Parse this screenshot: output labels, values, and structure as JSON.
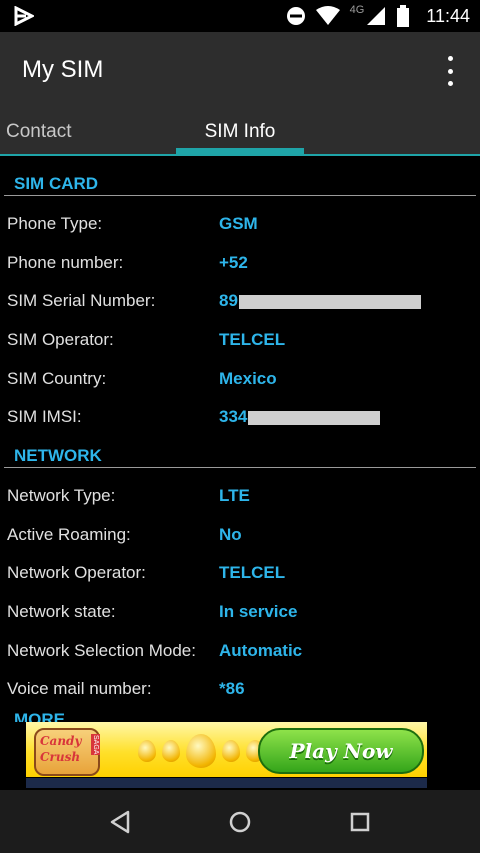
{
  "status_bar": {
    "network_label": "4G",
    "time": "11:44"
  },
  "app_bar": {
    "title": "My SIM"
  },
  "tabs": [
    {
      "label": "Contact",
      "selected": false
    },
    {
      "label": "SIM Info",
      "selected": true
    }
  ],
  "sim_card": {
    "header": "SIM CARD",
    "rows": [
      {
        "label": "Phone Type:",
        "value": "GSM"
      },
      {
        "label": "Phone number:",
        "value": "+52"
      },
      {
        "label": "SIM Serial Number:",
        "value": "89"
      },
      {
        "label": "SIM Operator:",
        "value": "TELCEL"
      },
      {
        "label": "SIM Country:",
        "value": "Mexico"
      },
      {
        "label": "SIM IMSI:",
        "value": "334"
      }
    ]
  },
  "network": {
    "header": "NETWORK",
    "rows": [
      {
        "label": "Network Type:",
        "value": "LTE"
      },
      {
        "label": "Active Roaming:",
        "value": "No"
      },
      {
        "label": "Network Operator:",
        "value": "TELCEL"
      },
      {
        "label": "Network state:",
        "value": "In service"
      },
      {
        "label": "Network Selection Mode:",
        "value": "Automatic"
      },
      {
        "label": "Voice mail number:",
        "value": "*86"
      }
    ]
  },
  "next_section": {
    "header": "MORE"
  },
  "ad": {
    "logo_line1": "Candy",
    "logo_line2": "Crush",
    "logo_tag": "SAGA",
    "button": "Play Now"
  },
  "colors": {
    "accent": "#2eb5ea",
    "tab_indicator": "#1fa4a8",
    "app_bar": "#2d2d2d",
    "background": "#000000"
  },
  "icons": {
    "status_left": "notification-play-icon",
    "dnd": "do-not-disturb-icon",
    "wifi": "wifi-icon",
    "signal": "cell-signal-icon",
    "battery": "battery-icon",
    "overflow": "overflow-menu-icon",
    "nav_back": "back-icon",
    "nav_home": "home-icon",
    "nav_recent": "recent-apps-icon"
  }
}
